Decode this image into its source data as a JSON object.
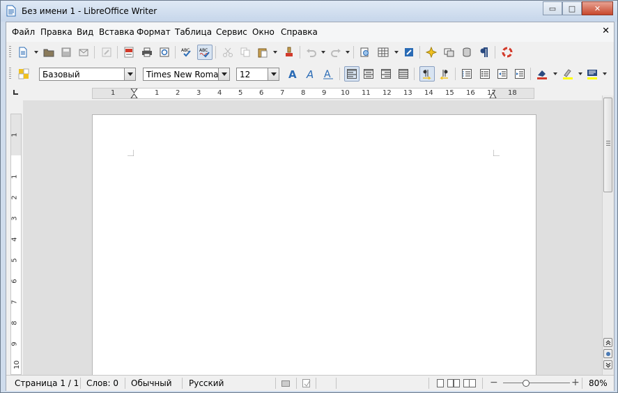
{
  "window": {
    "title": "Без имени 1 - LibreOffice Writer",
    "minimize_glyph": "▭",
    "maximize_glyph": "□",
    "close_glyph": "✕"
  },
  "menubar": {
    "items": [
      "Файл",
      "Правка",
      "Вид",
      "Вставка",
      "Формат",
      "Таблица",
      "Сервис",
      "Окно",
      "Справка"
    ],
    "close_glyph": "✕"
  },
  "formatting": {
    "paragraph_style": "Базовый",
    "font_name": "Times New Roman",
    "font_size": "12"
  },
  "ruler": {
    "h_ticks": [
      "1",
      "1",
      "2",
      "3",
      "4",
      "5",
      "6",
      "7",
      "8",
      "9",
      "10",
      "11",
      "12",
      "13",
      "14",
      "15",
      "16",
      "17",
      "18"
    ],
    "v_ticks": [
      "1",
      "1",
      "2",
      "3",
      "4",
      "5",
      "6",
      "7",
      "8",
      "9",
      "10"
    ]
  },
  "statusbar": {
    "page": "Страница 1 / 1",
    "words": "Слов: 0",
    "page_style": "Обычный",
    "language": "Русский",
    "zoom_minus": "−",
    "zoom_plus": "+",
    "zoom": "80%"
  },
  "colors": {
    "titlebar": "#cfdcec",
    "accent_red": "#c7472c",
    "highlight_yellow": "#ffff00"
  }
}
